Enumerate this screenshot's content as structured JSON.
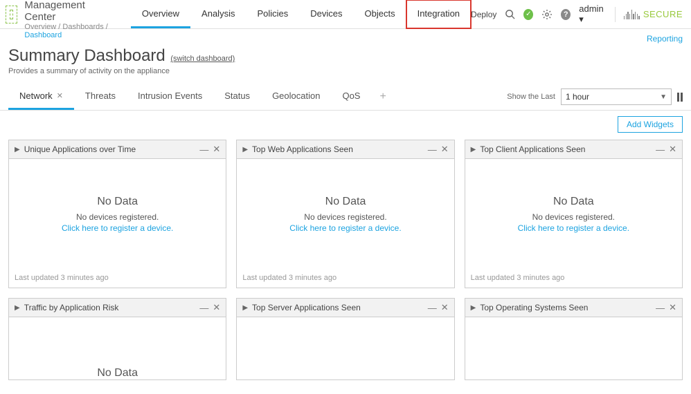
{
  "brand": {
    "title": "Firewall Management Center"
  },
  "breadcrumb": {
    "seg1": "Overview",
    "seg2": "Dashboards",
    "seg3": "Dashboard"
  },
  "nav": {
    "overview": "Overview",
    "analysis": "Analysis",
    "policies": "Policies",
    "devices": "Devices",
    "objects": "Objects",
    "integration": "Integration"
  },
  "topright": {
    "deploy": "Deploy",
    "user": "admin",
    "secure": "SECURE"
  },
  "links": {
    "reporting": "Reporting"
  },
  "page": {
    "title": "Summary Dashboard",
    "switch": "(switch dashboard)",
    "desc": "Provides a summary of activity on the appliance"
  },
  "tabs": {
    "network": "Network",
    "threats": "Threats",
    "intrusion": "Intrusion Events",
    "status": "Status",
    "geo": "Geolocation",
    "qos": "QoS",
    "showlast": "Show the Last",
    "timerange": "1 hour"
  },
  "toolbar": {
    "add_widgets": "Add Widgets"
  },
  "widget_common": {
    "nodata": "No Data",
    "noreg": "No devices registered.",
    "register_link": "Click here to register a device.",
    "updated": "Last updated 3 minutes ago"
  },
  "widgets": {
    "w1": "Unique Applications over Time",
    "w2": "Top Web Applications Seen",
    "w3": "Top Client Applications Seen",
    "w4": "Traffic by Application Risk",
    "w5": "Top Server Applications Seen",
    "w6": "Top Operating Systems Seen"
  }
}
